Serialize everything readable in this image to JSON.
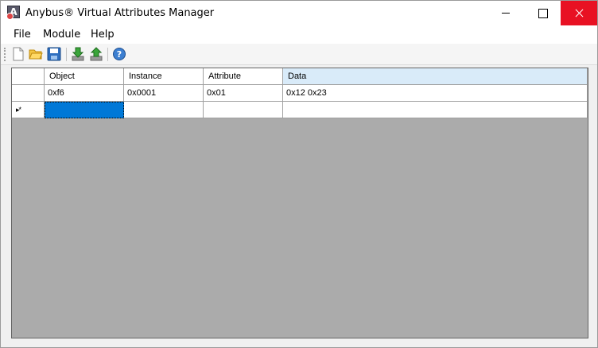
{
  "window": {
    "title": "Anybus® Virtual Attributes Manager",
    "app_icon_letter": "A"
  },
  "menu": {
    "file": "File",
    "module": "Module",
    "help": "Help"
  },
  "toolbar": {
    "icons": [
      "new-document-icon",
      "open-folder-icon",
      "save-icon",
      "download-icon",
      "upload-icon",
      "help-icon"
    ]
  },
  "grid": {
    "columns": [
      "Object",
      "Instance",
      "Attribute",
      "Data"
    ],
    "selected_column": "Data",
    "rows": [
      {
        "object": "0xf6",
        "instance": "0x0001",
        "attribute": "0x01",
        "data": "0x12 0x23"
      }
    ],
    "new_row_indicator": "▸*"
  },
  "colors": {
    "close_button": "#e81123",
    "grid_background": "#ababab",
    "selection": "#0078d7",
    "selected_header": "#d9ebf9"
  }
}
